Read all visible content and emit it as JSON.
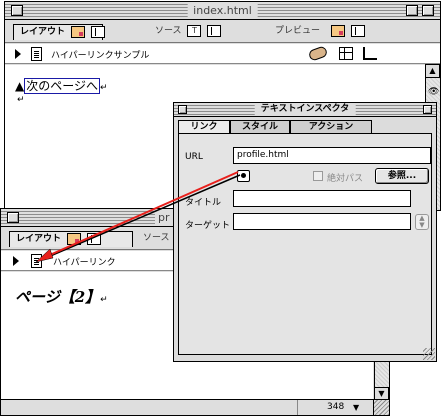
{
  "window1": {
    "title": "index.html",
    "tab_layout": "レイアウト",
    "tab_source": "ソース",
    "tab_preview": "プレビュー",
    "path_label": "ハイパーリンクサンプル",
    "link_prefix": "▲",
    "link_text": "次のページへ"
  },
  "window2": {
    "title": "pr",
    "tab_layout": "レイアウト",
    "tab_source": "ソース",
    "path_label": "ハイパーリンク",
    "heading": "ページ【2】",
    "status_number": "348"
  },
  "inspector": {
    "title": "テキストインスペクタ",
    "tabs": [
      "リンク",
      "スタイル",
      "アクション"
    ],
    "url_label": "URL",
    "url_value": "profile.html",
    "absolute_path_label": "絶対パス",
    "browse_button": "参照...",
    "title_label": "タイトル",
    "target_label": "ターゲット",
    "title_value": "",
    "target_value": ""
  },
  "colors": {
    "arrow": "#e8201c",
    "link_border": "#1a1aa6"
  }
}
